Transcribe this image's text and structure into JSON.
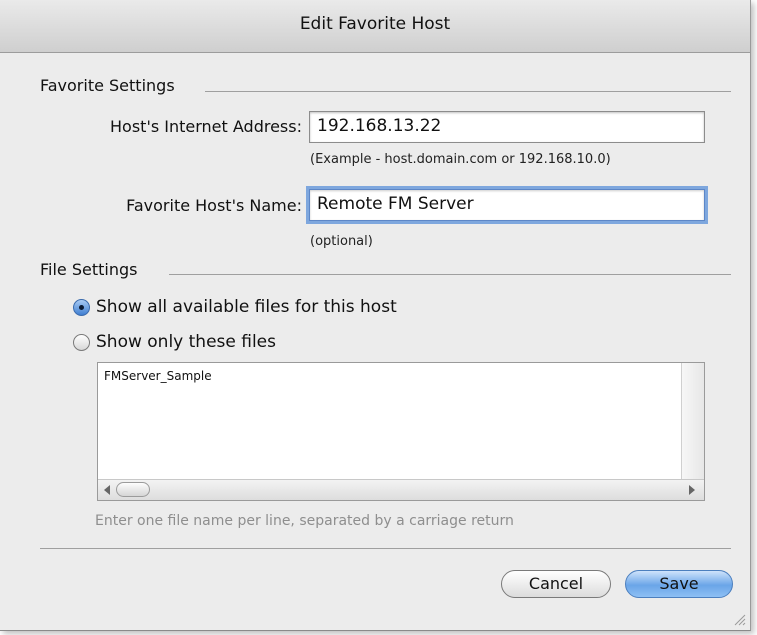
{
  "window": {
    "title": "Edit Favorite Host"
  },
  "favorite_settings": {
    "section_label": "Favorite Settings",
    "address_label": "Host's Internet Address:",
    "address_value": "192.168.13.22",
    "address_hint": "(Example - host.domain.com or 192.168.10.0)",
    "name_label": "Favorite Host's Name:",
    "name_value": "Remote FM Server",
    "name_hint": "(optional)"
  },
  "file_settings": {
    "section_label": "File Settings",
    "options": [
      {
        "label": "Show all available files for this host",
        "selected": true
      },
      {
        "label": "Show only these files",
        "selected": false
      }
    ],
    "files_text": "FMServer_Sample",
    "note": "Enter one file name per line, separated by a carriage return"
  },
  "buttons": {
    "cancel": "Cancel",
    "save": "Save"
  },
  "colors": {
    "accent": "#6aa5e8",
    "focus_ring": "#7ea7de",
    "dialog_bg": "#ececec"
  }
}
